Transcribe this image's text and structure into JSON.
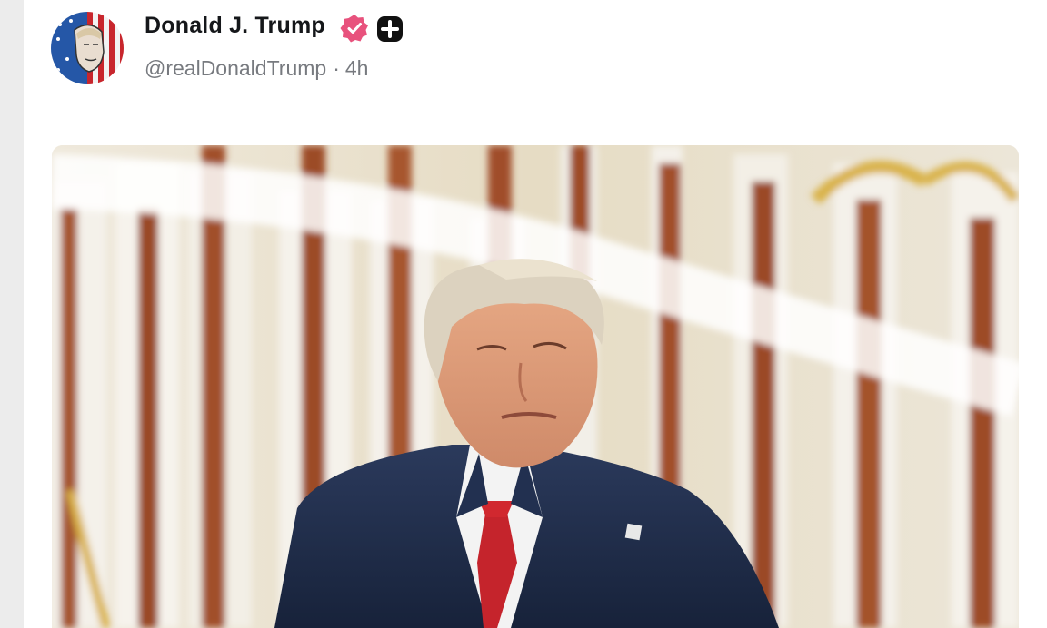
{
  "post": {
    "display_name": "Donald J. Trump",
    "handle": "@realDonaldTrump",
    "separator": "·",
    "time_ago": "4h"
  },
  "icons": {
    "avatar": "flag-portrait-avatar",
    "verified": "verified-badge-icon",
    "subscriber": "plus-badge-icon"
  },
  "colors": {
    "verified_badge": "#e8527d",
    "name_text": "#15171a",
    "handle_text": "#777a7f",
    "background": "#ffffff"
  }
}
